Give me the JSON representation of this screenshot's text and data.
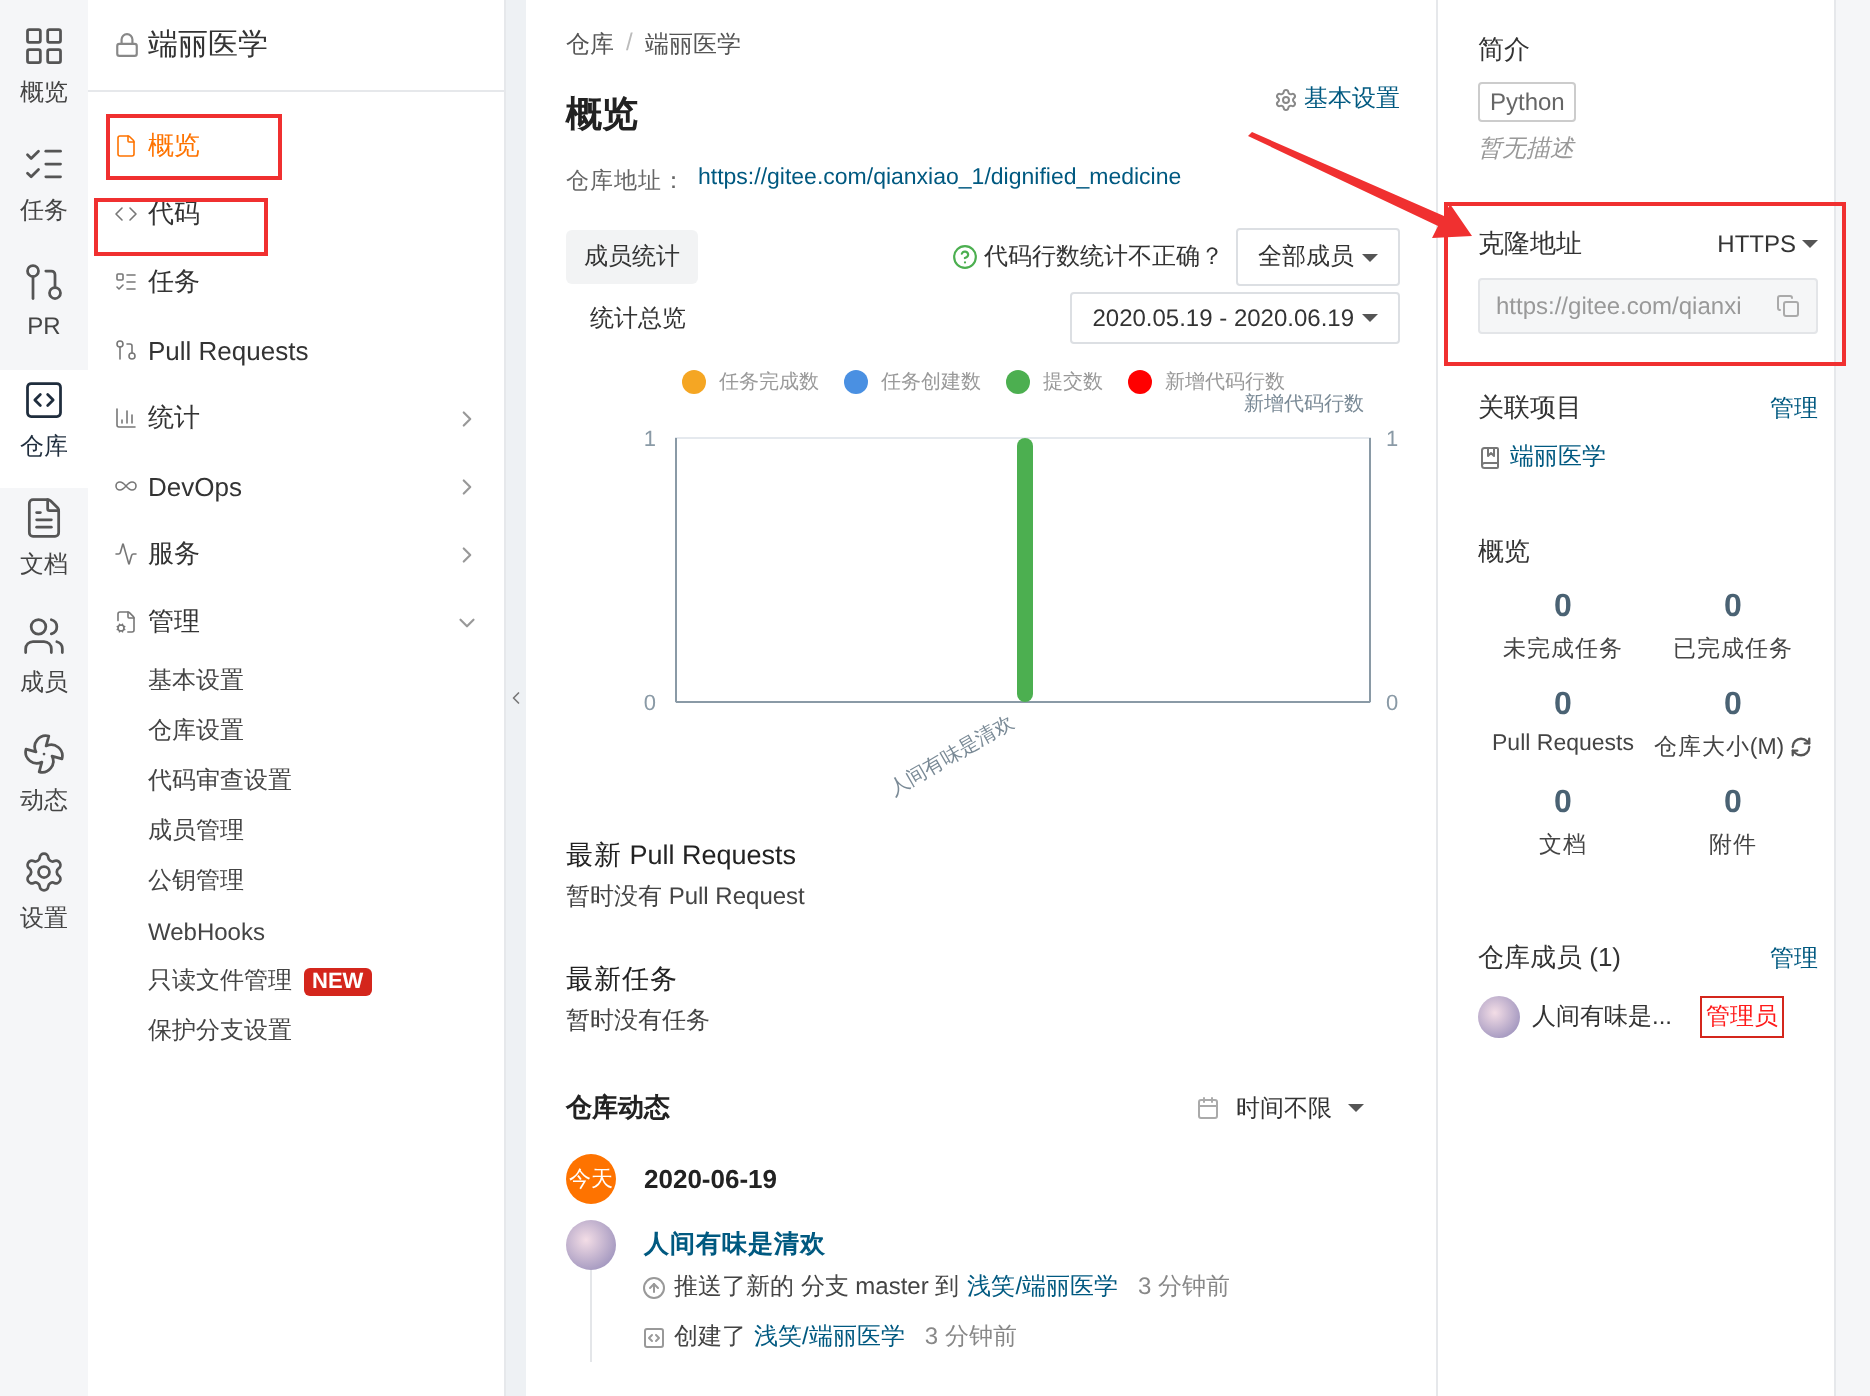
{
  "rail": [
    {
      "label": "概览",
      "selected": false
    },
    {
      "label": "任务",
      "selected": false
    },
    {
      "label": "PR",
      "selected": false
    },
    {
      "label": "仓库",
      "selected": true
    },
    {
      "label": "文档",
      "selected": false
    },
    {
      "label": "成员",
      "selected": false
    },
    {
      "label": "动态",
      "selected": false
    },
    {
      "label": "设置",
      "selected": false
    }
  ],
  "sidebar": {
    "title": "端丽医学",
    "items": [
      {
        "label": "概览",
        "selected": true
      },
      {
        "label": "代码",
        "selected": false
      },
      {
        "label": "任务",
        "selected": false
      },
      {
        "label": "Pull Requests",
        "selected": false
      },
      {
        "label": "统计",
        "selected": false,
        "expanded": false
      },
      {
        "label": "DevOps",
        "selected": false,
        "expanded": false
      },
      {
        "label": "服务",
        "selected": false,
        "expanded": false
      },
      {
        "label": "管理",
        "selected": false,
        "expanded": true,
        "children": [
          {
            "label": "基本设置"
          },
          {
            "label": "仓库设置"
          },
          {
            "label": "代码审查设置"
          },
          {
            "label": "成员管理"
          },
          {
            "label": "公钥管理"
          },
          {
            "label": "WebHooks"
          },
          {
            "label": "只读文件管理",
            "badge": "NEW"
          },
          {
            "label": "保护分支设置"
          }
        ]
      }
    ]
  },
  "main": {
    "breadcrumb": [
      "仓库",
      "端丽医学"
    ],
    "breadcrumb_separator": "/",
    "title": "概览",
    "settings_link": "基本设置",
    "address_label": "仓库地址：",
    "address": "https://gitee.com/qianxiao_1/dignified_medicine",
    "stats": {
      "tab": "成员统计",
      "subtitle": "统计总览",
      "help": "代码行数统计不正确？",
      "member_filter": "全部成员",
      "date_range": "2020.05.19 - 2020.06.19",
      "right_axis": {
        "label": "新增代码行数",
        "ticks": [
          "1",
          "0"
        ]
      },
      "chart_data": {
        "type": "bar",
        "categories": [
          "人间有味是清欢"
        ],
        "ylim": [
          0,
          1
        ],
        "yticks": [
          0,
          1
        ],
        "series": [
          {
            "name": "任务完成数",
            "color": "#f5a623",
            "values": [
              0
            ]
          },
          {
            "name": "任务创建数",
            "color": "#4a90e2",
            "values": [
              0
            ]
          },
          {
            "name": "提交数",
            "color": "#4caf50",
            "values": [
              1
            ]
          },
          {
            "name": "新增代码行数",
            "color": "#ff0000",
            "values": [
              0
            ]
          }
        ]
      }
    },
    "pull_requests": {
      "title": "最新 Pull Requests",
      "empty": "暂时没有 Pull Request"
    },
    "tasks": {
      "title": "最新任务",
      "empty": "暂时没有任务"
    },
    "activity": {
      "title": "仓库动态",
      "filter": "时间不限",
      "date_badge": "今天",
      "date": "2020-06-19",
      "user": "人间有味是清欢",
      "events": [
        {
          "kind": "push",
          "text": "推送了新的 分支 master 到",
          "link": "浅笑/端丽医学",
          "time": "3 分钟前"
        },
        {
          "kind": "create",
          "text": "创建了",
          "link": "浅笑/端丽医学",
          "time": "3 分钟前"
        }
      ]
    }
  },
  "right": {
    "intro": {
      "title": "简介",
      "tag": "Python",
      "description": "暂无描述"
    },
    "clone": {
      "title": "克隆地址",
      "protocol": "HTTPS",
      "url": "https://gitee.com/qianxi"
    },
    "related": {
      "title": "关联项目",
      "action": "管理",
      "project": "端丽医学"
    },
    "overview": {
      "title": "概览",
      "stats": [
        {
          "value": "0",
          "label": "未完成任务",
          "refresh": false
        },
        {
          "value": "0",
          "label": "已完成任务",
          "refresh": false
        },
        {
          "value": "0",
          "label": "Pull Requests",
          "refresh": false
        },
        {
          "value": "0",
          "label": "仓库大小(M)",
          "refresh": true
        },
        {
          "value": "0",
          "label": "文档",
          "refresh": false
        },
        {
          "value": "0",
          "label": "附件",
          "refresh": false
        }
      ]
    },
    "members": {
      "title": "仓库成员 (1)",
      "action": "管理",
      "list": [
        {
          "name": "人间有味是...",
          "role": "管理员"
        }
      ]
    }
  }
}
